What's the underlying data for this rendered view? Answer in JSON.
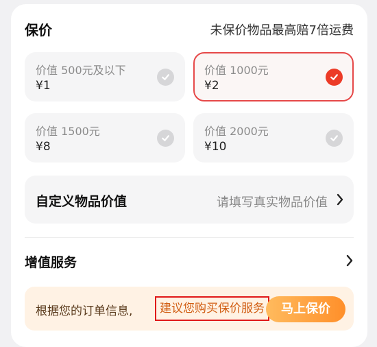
{
  "insurance": {
    "title": "保价",
    "note": "未保价物品最高赔7倍运费",
    "options": [
      {
        "label": "价值 500元及以下",
        "price": "¥1",
        "selected": false
      },
      {
        "label": "价值 1000元",
        "price": "¥2",
        "selected": true
      },
      {
        "label": "价值 1500元",
        "price": "¥8",
        "selected": false
      },
      {
        "label": "价值 2000元",
        "price": "¥10",
        "selected": false
      }
    ],
    "custom": {
      "label": "自定义物品价值",
      "placeholder": "请填写真实物品价值"
    }
  },
  "value_added": {
    "title": "增值服务"
  },
  "banner": {
    "message": "根据您的订单信息,",
    "highlight": "建议您购买保价服务",
    "button": "马上保价"
  },
  "colors": {
    "selected": "#e64848",
    "accent": "#ff8f2a"
  }
}
